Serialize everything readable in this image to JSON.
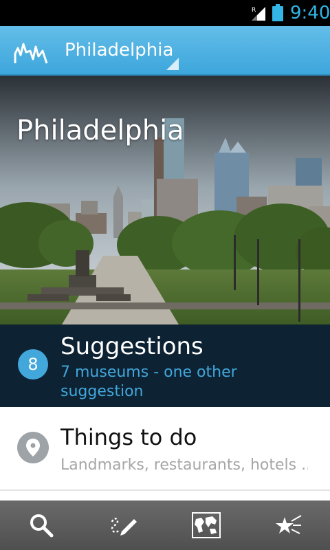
{
  "status_bar": {
    "time": "9:40",
    "signal_indicator": "R",
    "icons": [
      "signal-icon",
      "battery-icon"
    ]
  },
  "action_bar": {
    "city": "Philadelphia",
    "accent_color": "#42a7db"
  },
  "hero": {
    "title": "Philadelphia"
  },
  "sections": {
    "suggestions": {
      "count": "8",
      "title": "Suggestions",
      "subtitle": "7 museums - one other suggestion"
    },
    "things_to_do": {
      "title": "Things to do",
      "subtitle": "Landmarks, restaurants, hotels ..."
    }
  },
  "bottom_bar": {
    "icons": [
      "search-icon",
      "edit-icon",
      "map-icon",
      "favorites-icon"
    ]
  }
}
